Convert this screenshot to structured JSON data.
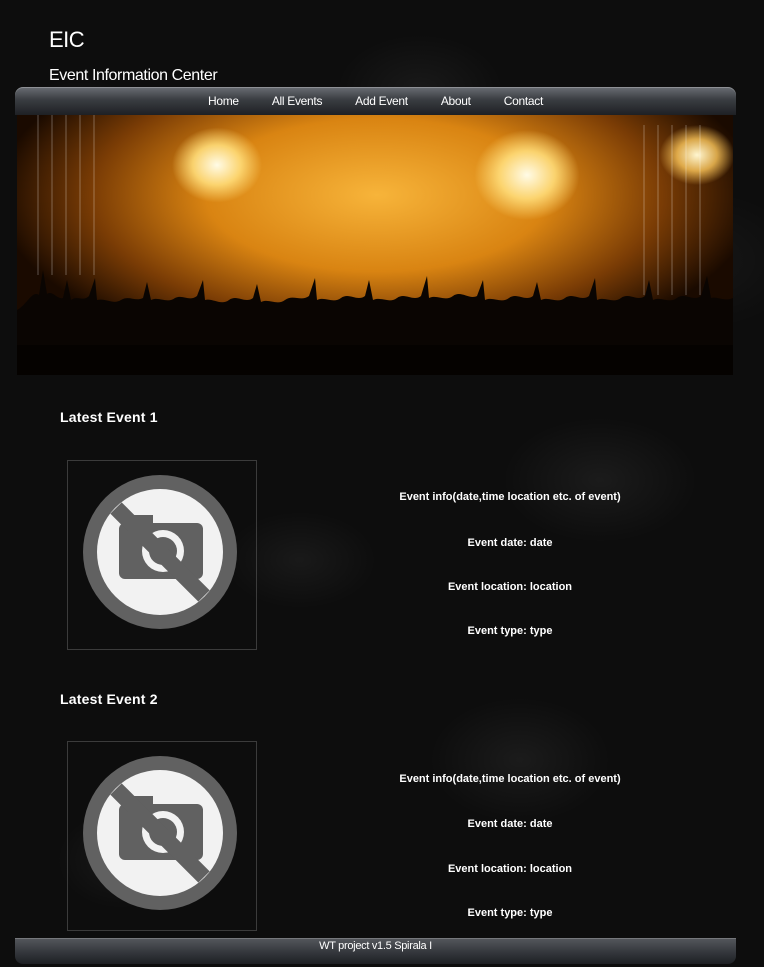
{
  "header": {
    "title": "EIC",
    "subtitle": "Event Information Center"
  },
  "nav": {
    "items": [
      {
        "label": "Home"
      },
      {
        "label": "All Events"
      },
      {
        "label": "Add Event"
      },
      {
        "label": "About"
      },
      {
        "label": "Contact"
      }
    ]
  },
  "hero": {
    "image_icon": "concert-crowd-image"
  },
  "events": [
    {
      "heading": "Latest Event 1",
      "image_icon": "no-photo-icon",
      "info": "Event info(date,time location etc. of event)",
      "date": "Event date: date",
      "location": "Event location: location",
      "type": "Event type: type"
    },
    {
      "heading": "Latest Event 2",
      "image_icon": "no-photo-icon",
      "info": "Event info(date,time location etc. of event)",
      "date": "Event date: date",
      "location": "Event location: location",
      "type": "Event type: type"
    }
  ],
  "footer": {
    "text": "WT project v1.5 Spirala I"
  },
  "colors": {
    "nav_top": "#6a6e74",
    "nav_bottom": "#1e2024",
    "background": "#0d0d0d",
    "icon_gray": "#616161",
    "icon_light": "#f2f2f2"
  }
}
